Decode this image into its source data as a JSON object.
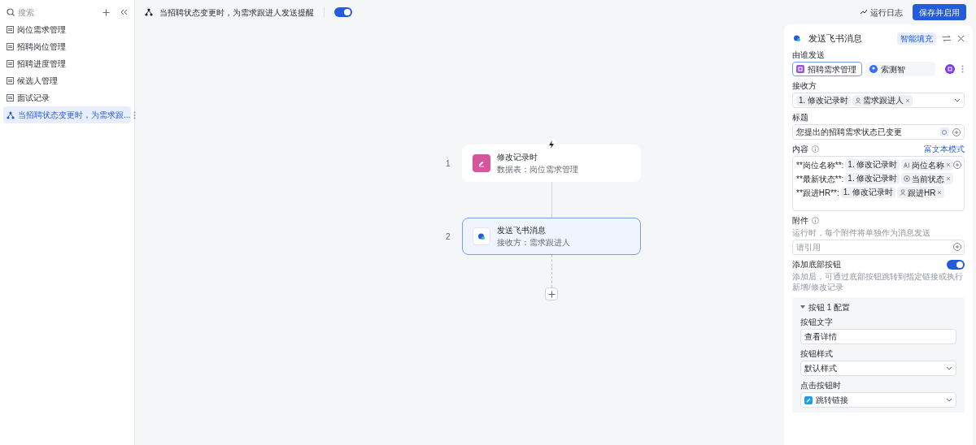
{
  "sidebar": {
    "search": {
      "placeholder": "搜索"
    },
    "items": [
      {
        "kind": "table",
        "label": "岗位需求管理",
        "selected": false
      },
      {
        "kind": "table",
        "label": "招聘岗位管理",
        "selected": false
      },
      {
        "kind": "table",
        "label": "招聘进度管理",
        "selected": false
      },
      {
        "kind": "table",
        "label": "候选人管理",
        "selected": false
      },
      {
        "kind": "table",
        "label": "面试记录",
        "selected": false
      },
      {
        "kind": "workflow",
        "label": "当招聘状态变更时，为需求跟...",
        "selected": true
      }
    ]
  },
  "toolbar": {
    "workflow_title": "当招聘状态变更时，为需求跟进人发送提醒",
    "enabled": true,
    "log_button": "运行日志",
    "save_button": "保存并启用"
  },
  "canvas": {
    "nodes": [
      {
        "kind": "trigger",
        "number": "1",
        "title": "修改记录时",
        "subtitle": "数据表：岗位需求管理",
        "selected": false
      },
      {
        "kind": "message",
        "number": "2",
        "title": "发送飞书消息",
        "subtitle": "接收方：需求跟进人",
        "selected": true
      }
    ]
  },
  "panel": {
    "title": "发送飞书消息",
    "smart_fill": "智能填充",
    "sender": {
      "label": "由谁发送",
      "options": [
        {
          "kind": "app",
          "label": "招聘需求管理",
          "selected": true
        },
        {
          "kind": "bot",
          "label": "索测智",
          "selected": false
        }
      ]
    },
    "receiver": {
      "label": "接收方",
      "step": "1. 修改记录时",
      "field": "需求跟进人"
    },
    "subject": {
      "label": "标题",
      "value": "您提出的招聘需求状态已变更"
    },
    "content": {
      "label": "内容",
      "mode": "富文本模式",
      "lines": [
        {
          "prefix": "**岗位名称**:",
          "step": "1. 修改记录时",
          "kind": "text",
          "field": "岗位名称"
        },
        {
          "prefix": "**最新状态**:",
          "step": "1. 修改记录时",
          "kind": "status",
          "field": "当前状态"
        },
        {
          "prefix": "**跟进HR**:",
          "step": "1. 修改记录时",
          "kind": "person",
          "field": "跟进HR"
        }
      ]
    },
    "attachment": {
      "label": "附件",
      "hint": "运行时，每个附件将单独作为消息发送",
      "placeholder": "请引用"
    },
    "bottom_button": {
      "label": "添加底部按钮",
      "on": true,
      "hint": "添加后，可通过底部按钮跳转到指定链接或执行新增/修改记录"
    },
    "button_config": {
      "title": "按钮 1 配置",
      "expanded": true,
      "text_label": "按钮文字",
      "text_value": "查看详情",
      "style_label": "按钮样式",
      "style_value": "默认样式",
      "click_label": "点击按钮时",
      "click_value": "跳转链接"
    }
  }
}
